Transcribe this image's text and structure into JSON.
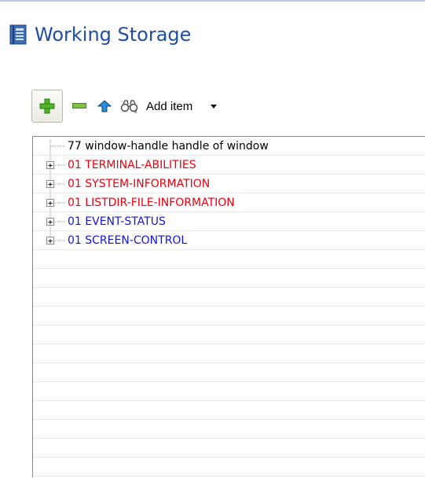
{
  "header": {
    "title": "Working Storage",
    "icon": "book-icon"
  },
  "toolbar": {
    "add_icon": "plus-icon",
    "remove_icon": "minus-icon",
    "up_icon": "arrow-up-icon",
    "find_icon": "binoculars-icon",
    "add_item_label": "Add item",
    "dropdown_icon": "dropdown-arrow-icon"
  },
  "colors": {
    "title": "#1f4e9f",
    "red_item": "#e8000c",
    "blue_item": "#1515d8",
    "black_item": "#000000"
  },
  "tree": {
    "items": [
      {
        "label": "77 window-handle handle of window",
        "color": "#000000",
        "expandable": false
      },
      {
        "label": "01 TERMINAL-ABILITIES",
        "color": "#e8000c",
        "expandable": true
      },
      {
        "label": "01 SYSTEM-INFORMATION",
        "color": "#e8000c",
        "expandable": true
      },
      {
        "label": "01 LISTDIR-FILE-INFORMATION",
        "color": "#e8000c",
        "expandable": true
      },
      {
        "label": "01 EVENT-STATUS",
        "color": "#1515d8",
        "expandable": true
      },
      {
        "label": "01 SCREEN-CONTROL",
        "color": "#1515d8",
        "expandable": true
      }
    ]
  }
}
